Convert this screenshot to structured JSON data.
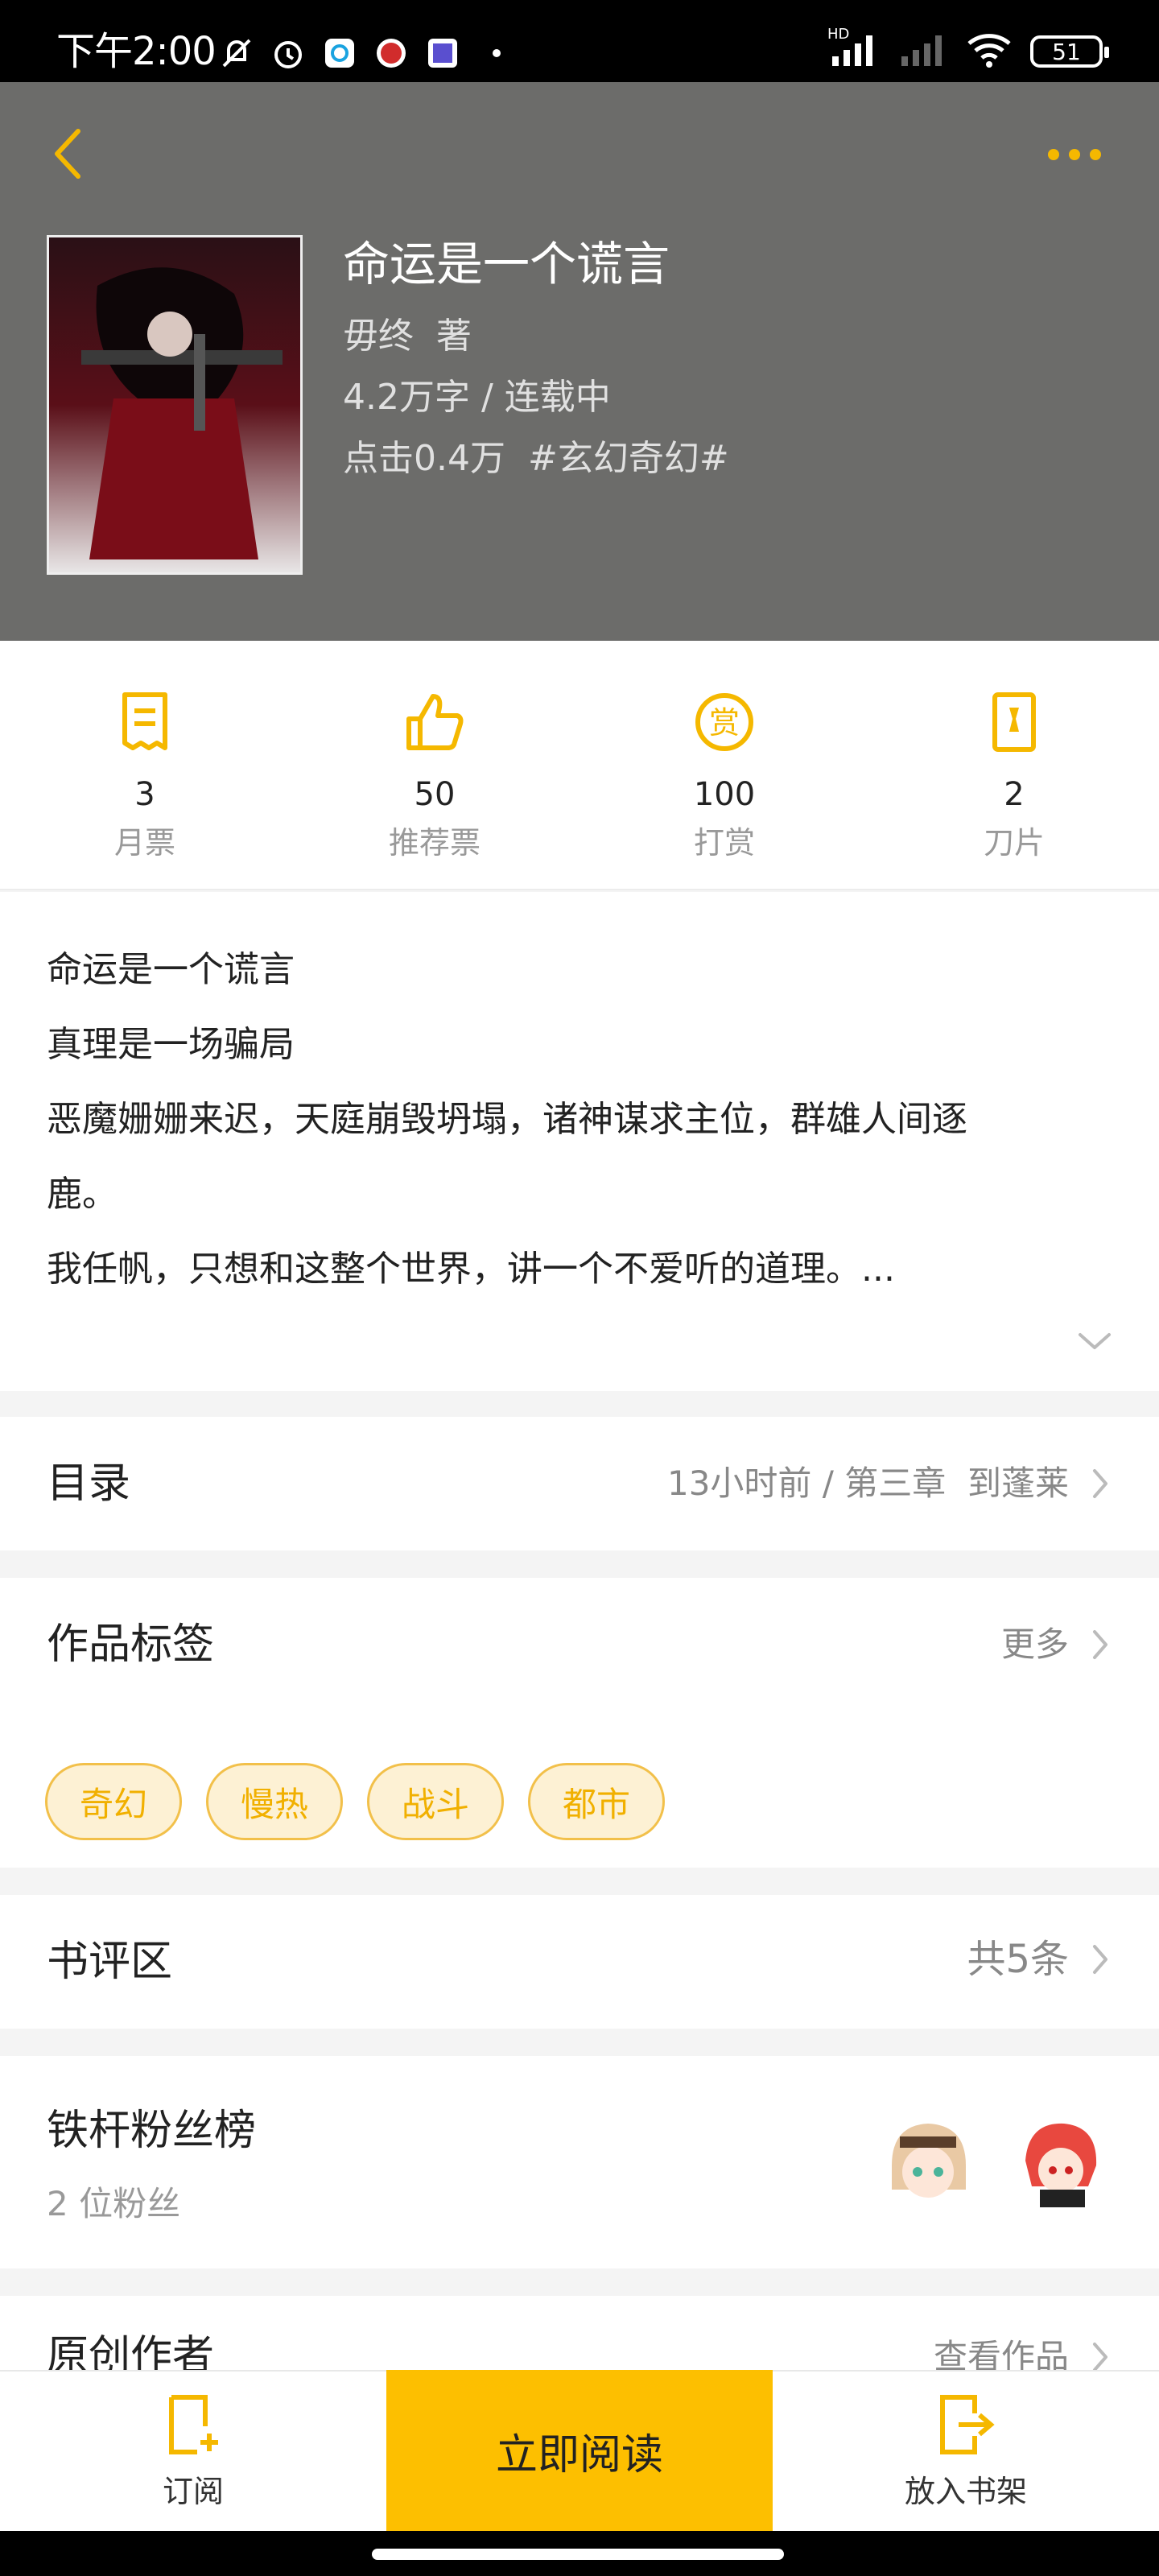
{
  "status_bar": {
    "time": "下午2:00",
    "battery": "51",
    "network_label": "HD"
  },
  "book": {
    "title": "命运是一个谎言",
    "author": "毋终",
    "author_suffix": "著",
    "word_count": "4.2万字",
    "status": "连载中",
    "clicks": "点击0.4万",
    "genre_tag": "#玄幻奇幻#"
  },
  "stats": [
    {
      "value": "3",
      "label": "月票",
      "icon": "monthly-ticket-icon"
    },
    {
      "value": "50",
      "label": "推荐票",
      "icon": "thumbs-up-icon"
    },
    {
      "value": "100",
      "label": "打赏",
      "icon": "reward-icon"
    },
    {
      "value": "2",
      "label": "刀片",
      "icon": "blade-icon"
    }
  ],
  "description": {
    "lines": [
      "命运是一个谎言",
      "真理是一场骗局",
      "恶魔姗姗来迟，天庭崩毁坍塌，诸神谋求主位，群雄人间逐",
      "鹿。",
      "我任帆，只想和这整个世界，讲一个不爱听的道理。..."
    ]
  },
  "catalog": {
    "title": "目录",
    "updated": "13小时前",
    "separator": "/",
    "latest_chapter": "第三章  到蓬莱"
  },
  "tags_section": {
    "title": "作品标签",
    "more": "更多",
    "tags": [
      "奇幻",
      "慢热",
      "战斗",
      "都市"
    ]
  },
  "reviews": {
    "title": "书评区",
    "count": "共5条"
  },
  "fans": {
    "title": "铁杆粉丝榜",
    "count": "2 位粉丝"
  },
  "original_author": {
    "title": "原创作者",
    "link": "查看作品"
  },
  "bottom_bar": {
    "subscribe": "订阅",
    "read_now": "立即阅读",
    "add_shelf": "放入书架"
  },
  "colors": {
    "accent": "#fdbf00",
    "header_bg": "#6c6c6a",
    "tag_bg": "#fdf1d4"
  }
}
